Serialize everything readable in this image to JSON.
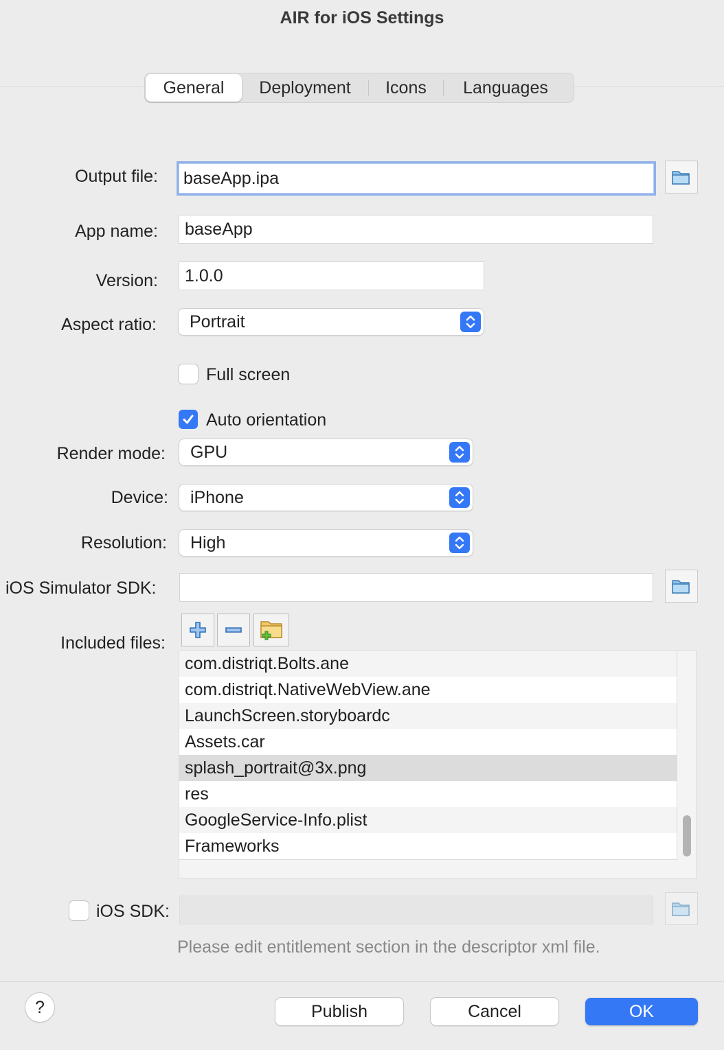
{
  "window": {
    "title": "AIR for iOS Settings"
  },
  "tabs": [
    {
      "label": "General",
      "active": true
    },
    {
      "label": "Deployment",
      "active": false
    },
    {
      "label": "Icons",
      "active": false
    },
    {
      "label": "Languages",
      "active": false
    }
  ],
  "form": {
    "output_file": {
      "label": "Output file:",
      "value": "baseApp.ipa"
    },
    "app_name": {
      "label": "App name:",
      "value": "baseApp"
    },
    "version": {
      "label": "Version:",
      "value": "1.0.0"
    },
    "aspect_ratio": {
      "label": "Aspect ratio:",
      "value": "Portrait"
    },
    "full_screen": {
      "label": "Full screen",
      "checked": false
    },
    "auto_orientation": {
      "label": "Auto orientation",
      "checked": true
    },
    "render_mode": {
      "label": "Render mode:",
      "value": "GPU"
    },
    "device": {
      "label": "Device:",
      "value": "iPhone"
    },
    "resolution": {
      "label": "Resolution:",
      "value": "High"
    },
    "ios_simulator_sdk": {
      "label": "iOS Simulator SDK:",
      "value": ""
    },
    "included_files": {
      "label": "Included files:",
      "files": [
        "com.distriqt.Bolts.ane",
        "com.distriqt.NativeWebView.ane",
        "LaunchScreen.storyboardc",
        "Assets.car",
        "splash_portrait@3x.png",
        "res",
        "GoogleService-Info.plist",
        "Frameworks"
      ],
      "selected_index": 4
    },
    "ios_sdk": {
      "label": "iOS SDK:",
      "checked": false,
      "value": ""
    },
    "hint": "Please edit entitlement section in the descriptor xml file."
  },
  "buttons": {
    "help": "?",
    "publish": "Publish",
    "cancel": "Cancel",
    "ok": "OK"
  },
  "colors": {
    "accent": "#3478f6",
    "focus_ring": "#8fb0ea"
  },
  "icons": {
    "browse": "folder-icon",
    "add": "plus-icon",
    "remove": "minus-icon",
    "add_folder": "add-folder-icon",
    "stepper": "chevron-up-down-icon",
    "check": "checkmark-icon"
  }
}
